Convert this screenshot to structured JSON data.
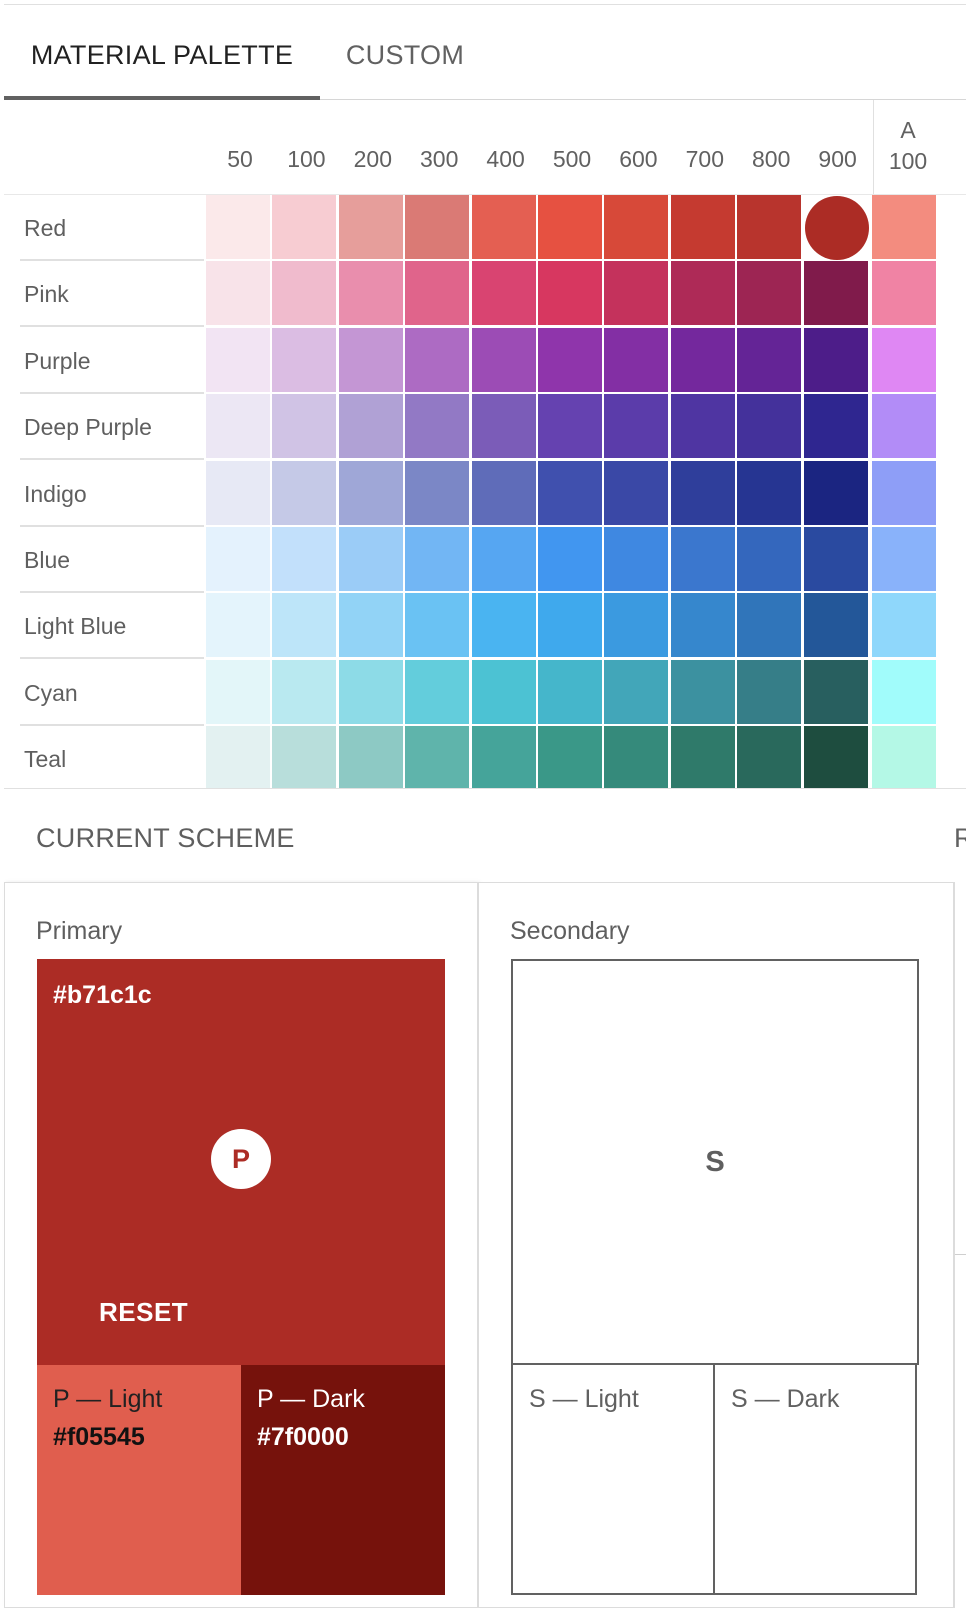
{
  "tabs": [
    {
      "label": "MATERIAL PALETTE",
      "active": true
    },
    {
      "label": "CUSTOM",
      "active": false
    }
  ],
  "palette": {
    "columns": [
      "50",
      "100",
      "200",
      "300",
      "400",
      "500",
      "600",
      "700",
      "800",
      "900"
    ],
    "accent_column": {
      "line1": "A",
      "line2": "100"
    },
    "selected": {
      "row": "Red",
      "shade": "900"
    },
    "rows": [
      {
        "name": "Red",
        "colors": [
          "#fbe9ea",
          "#f7ccd2",
          "#e69e9b",
          "#da7a75",
          "#e45f52",
          "#e65141",
          "#d74939",
          "#c53a30",
          "#b8342d",
          "#ac2c25"
        ],
        "accent": "#f38c7f"
      },
      {
        "name": "Pink",
        "colors": [
          "#f8e3e9",
          "#f0bbcd",
          "#e98ead",
          "#e0648b",
          "#d94471",
          "#d73760",
          "#c4325c",
          "#ae2a57",
          "#9d2553",
          "#801b4b"
        ],
        "accent": "#f083a4"
      },
      {
        "name": "Purple",
        "colors": [
          "#f2e4f3",
          "#dbbde3",
          "#c496d4",
          "#ad6bc3",
          "#9c4cb5",
          "#8f35ab",
          "#832fa4",
          "#74289d",
          "#642496",
          "#4d1d89"
        ],
        "accent": "#df87f3"
      },
      {
        "name": "Deep Purple",
        "colors": [
          "#ece7f4",
          "#d0c3e5",
          "#b0a1d5",
          "#9279c5",
          "#7b5cb8",
          "#6542b0",
          "#5b3caa",
          "#4f35a2",
          "#44319b",
          "#2f2690"
        ],
        "accent": "#b28cf7"
      },
      {
        "name": "Indigo",
        "colors": [
          "#e7e9f5",
          "#c5c9e7",
          "#9fa7d7",
          "#7b87c6",
          "#5f6cb9",
          "#4050ae",
          "#3a48a6",
          "#2f3e9b",
          "#263592",
          "#1b2581"
        ],
        "accent": "#8e9ef7"
      },
      {
        "name": "Blue",
        "colors": [
          "#e4f2fd",
          "#c2e0fb",
          "#9bccf7",
          "#72b6f4",
          "#56a6f2",
          "#4196f0",
          "#3f88e1",
          "#3b77ce",
          "#3467bd",
          "#2a4aa0"
        ],
        "accent": "#89b2fa"
      },
      {
        "name": "Light Blue",
        "colors": [
          "#e4f4fc",
          "#bde5f9",
          "#92d3f6",
          "#6ac2f3",
          "#4ab4f1",
          "#3fa9ed",
          "#3b9ae0",
          "#3687cd",
          "#3075ba",
          "#235799"
        ],
        "accent": "#8fd7fb"
      },
      {
        "name": "Cyan",
        "colors": [
          "#e3f6f9",
          "#b9e9f0",
          "#8ddbe7",
          "#63cddc",
          "#4cc2d3",
          "#45b6cb",
          "#42a6b9",
          "#3c91a0",
          "#367e88",
          "#285f5f"
        ],
        "accent": "#a1fcfb"
      },
      {
        "name": "Teal",
        "colors": [
          "#e3f1f1",
          "#b8dedb",
          "#8dc9c4",
          "#5fb4ab",
          "#45a49a",
          "#3a9888",
          "#358a7b",
          "#2f7a6a",
          "#29695c",
          "#1e4d3f"
        ],
        "accent": "#b4f8e6"
      }
    ]
  },
  "scheme": {
    "title": "CURRENT SCHEME",
    "cut_label": "R",
    "primary": {
      "label": "Primary",
      "hex": "#b71c1c",
      "badge": "P",
      "reset_label": "RESET",
      "color": "#ac2c25",
      "light": {
        "label": "P — Light",
        "hex": "#f05545",
        "color": "#e05e4e"
      },
      "dark": {
        "label": "P — Dark",
        "hex": "#7f0000",
        "color": "#76120c"
      }
    },
    "secondary": {
      "label": "Secondary",
      "badge": "S",
      "light": {
        "label": "S — Light"
      },
      "dark": {
        "label": "S — Dark"
      }
    }
  }
}
